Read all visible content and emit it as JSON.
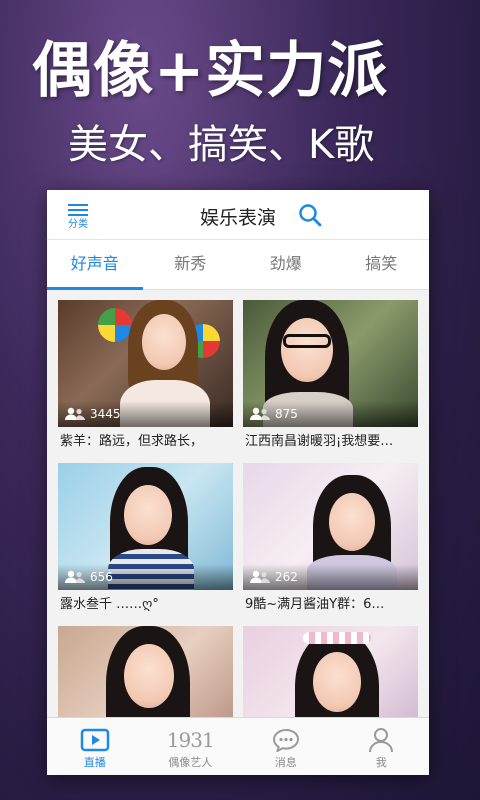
{
  "promo": {
    "title": "偶像+实力派",
    "subtitle": "美女、搞笑、K歌"
  },
  "header": {
    "menu_label": "分类",
    "title": "娱乐表演"
  },
  "tabs": [
    {
      "label": "好声音",
      "active": true
    },
    {
      "label": "新秀",
      "active": false
    },
    {
      "label": "劲爆",
      "active": false
    },
    {
      "label": "搞笑",
      "active": false
    }
  ],
  "streams": [
    {
      "viewers": "3445",
      "caption": "紫羊：路远，但求路长，"
    },
    {
      "viewers": "875",
      "caption": "江西南昌谢暖羽¡我想要…"
    },
    {
      "viewers": "656",
      "caption": "露水叁千 ……ღ°"
    },
    {
      "viewers": "262",
      "caption": "9酷~满月酱油Y群：6…"
    },
    {
      "viewers": "",
      "caption": ""
    },
    {
      "viewers": "",
      "caption": ""
    }
  ],
  "bottom_nav": [
    {
      "label": "直播",
      "icon": "live-play-icon",
      "active": true
    },
    {
      "label": "偶像艺人",
      "icon": "idol-number",
      "number": "1931",
      "active": false
    },
    {
      "label": "消息",
      "icon": "message-bubble-icon",
      "active": false
    },
    {
      "label": "我",
      "icon": "person-icon",
      "active": false
    }
  ],
  "colors": {
    "accent": "#1e88e5"
  }
}
